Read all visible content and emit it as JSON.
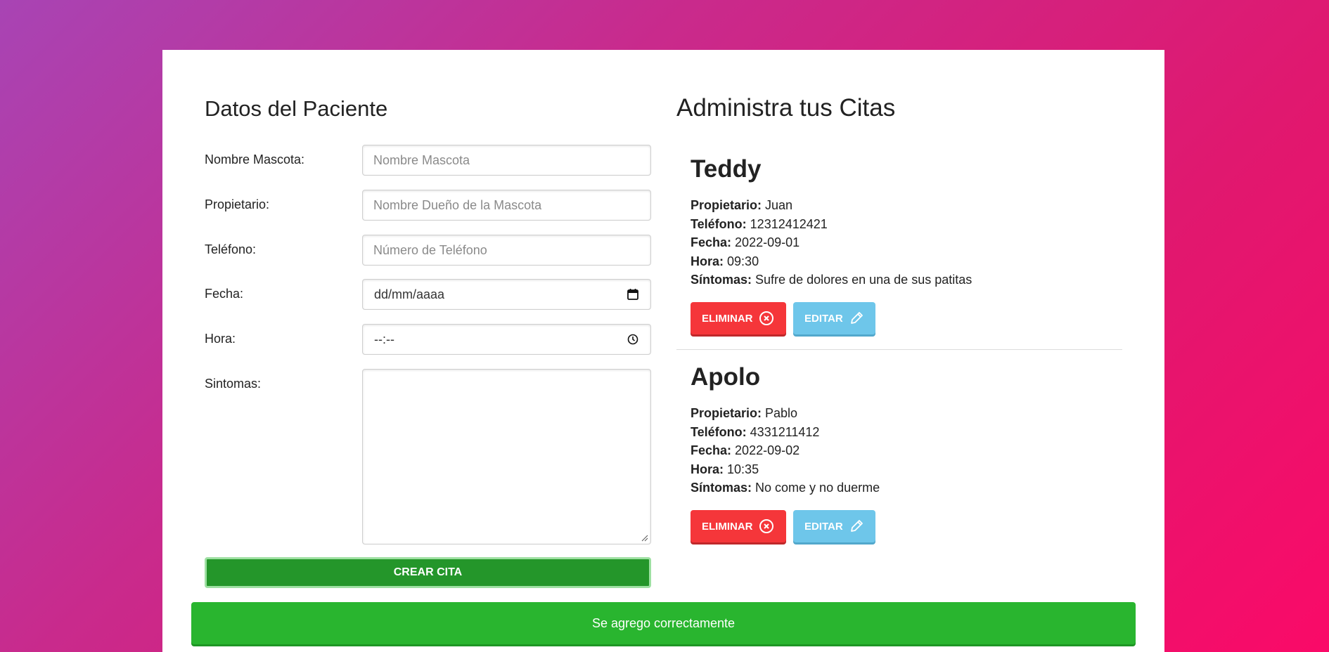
{
  "form": {
    "title": "Datos del Paciente",
    "fields": [
      {
        "label": "Nombre Mascota:",
        "placeholder": "Nombre Mascota"
      },
      {
        "label": "Propietario:",
        "placeholder": "Nombre Dueño de la Mascota"
      },
      {
        "label": "Teléfono:",
        "placeholder": "Número de Teléfono"
      },
      {
        "label": "Fecha:",
        "value": "dd/mm/aaaa",
        "icon": "calendar-icon"
      },
      {
        "label": "Hora:",
        "value": "--:--",
        "icon": "clock-icon"
      },
      {
        "label": "Sintomas:"
      }
    ],
    "submit_label": "CREAR CITA"
  },
  "citas": {
    "title": "Administra tus Citas",
    "items": [
      {
        "mascota": "Teddy",
        "propietario_label": "Propietario:",
        "propietario": "Juan",
        "telefono_label": "Teléfono:",
        "telefono": "12312412421",
        "fecha_label": "Fecha:",
        "fecha": "2022-09-01",
        "hora_label": "Hora:",
        "hora": "09:30",
        "sintomas_label": "Síntomas:",
        "sintomas": "Sufre de dolores en una de sus patitas",
        "delete_label": "ELIMINAR",
        "edit_label": "EDITAR"
      },
      {
        "mascota": "Apolo",
        "propietario_label": "Propietario:",
        "propietario": "Pablo",
        "telefono_label": "Teléfono:",
        "telefono": "4331211412",
        "fecha_label": "Fecha:",
        "fecha": "2022-09-02",
        "hora_label": "Hora:",
        "hora": "10:35",
        "sintomas_label": "Síntomas:",
        "sintomas": "No come y no duerme",
        "delete_label": "ELIMINAR",
        "edit_label": "EDITAR"
      }
    ]
  },
  "alert": {
    "message": "Se agrego correctamente",
    "color": "#29b52f"
  },
  "colors": {
    "delete": "#f5363a",
    "edit": "#6ec6ea",
    "submit": "#24962a"
  }
}
